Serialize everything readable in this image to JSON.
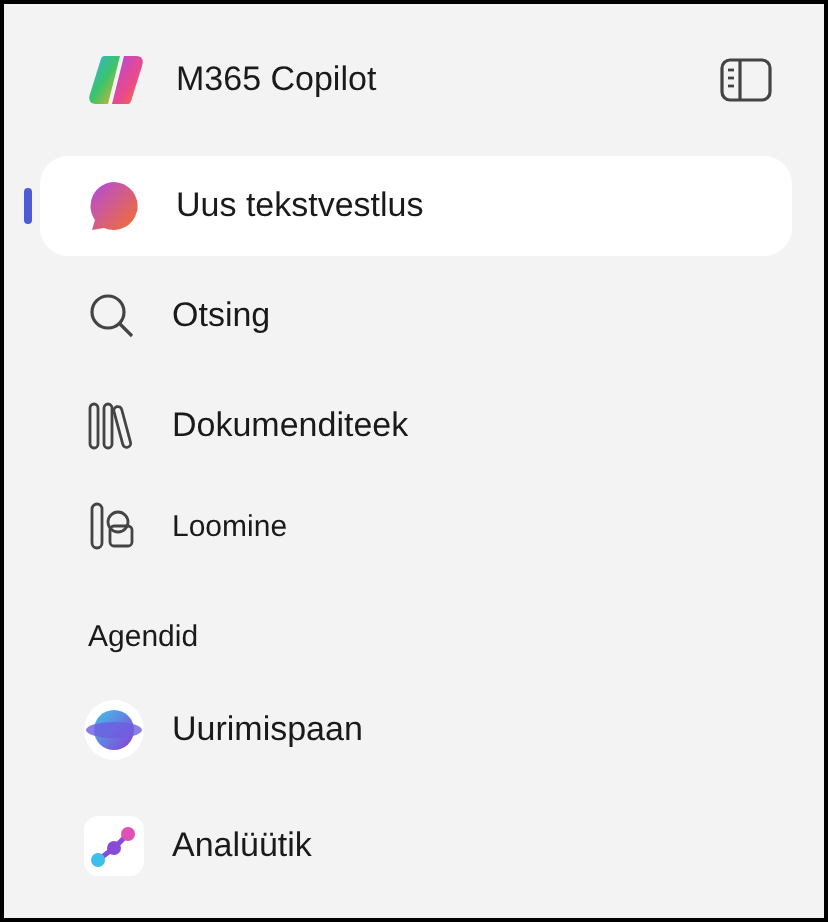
{
  "header": {
    "title": "M365 Copilot"
  },
  "nav": [
    {
      "kind": "chat",
      "label": "Uus tekstvestlus",
      "selected": true
    },
    {
      "kind": "search",
      "label": "Otsing",
      "selected": false
    },
    {
      "kind": "library",
      "label": "Dokumenditeek",
      "selected": false
    },
    {
      "kind": "create",
      "label": "Loomine",
      "selected": false
    }
  ],
  "agents": {
    "heading": "Agendid",
    "items": [
      {
        "kind": "researcher",
        "label": "Uurimispaan"
      },
      {
        "kind": "analyst",
        "label": "Analüütik"
      }
    ]
  }
}
